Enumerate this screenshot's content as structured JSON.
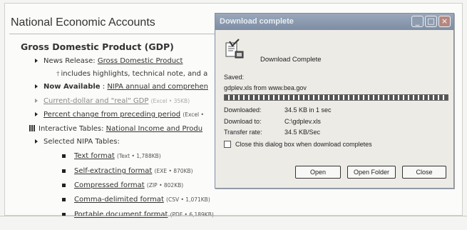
{
  "page": {
    "title": "National Economic Accounts",
    "section_heading": "Gross Domestic Product (GDP)",
    "news": {
      "label": "News Release:",
      "link": "Gross Domestic Product"
    },
    "note": "includes highlights, technical note, and a",
    "available": {
      "label": "Now Available",
      "link": "NIPA annual and comprehen"
    },
    "current_dollar": {
      "link": "Current-dollar and \"real\" GDP",
      "meta": "(Excel • 35KB)"
    },
    "percent_change": {
      "link": "Percent change from preceding period",
      "meta": "(Excel •"
    },
    "interactive": {
      "label": "Interactive Tables:",
      "link": "National Income and Produ"
    },
    "selected": "Selected NIPA Tables:",
    "files": [
      {
        "link": "Text format",
        "meta": "(Text • 1,788KB)"
      },
      {
        "link": "Self-extracting format",
        "meta": "(EXE • 870KB)"
      },
      {
        "link": "Compressed format",
        "meta": "(ZIP • 802KB)"
      },
      {
        "link": "Comma-delimited format",
        "meta": "(CSV • 1,071KB)"
      },
      {
        "link": "Portable document format",
        "meta": "(PDF • 6,189KB)"
      }
    ]
  },
  "dialog": {
    "title": "Download complete",
    "heading": "Download Complete",
    "saved_label": "Saved:",
    "saved_value": "gdplev.xls from www.bea.gov",
    "progress": 1.0,
    "downloaded_label": "Downloaded:",
    "downloaded_value": "34.5 KB in 1 sec",
    "download_to_label": "Download to:",
    "download_to_value": "C:\\gdplev.xls",
    "rate_label": "Transfer rate:",
    "rate_value": "34.5 KB/Sec",
    "close_checkbox": "Close this dialog box when download completes",
    "close_checkbox_checked": false,
    "buttons": {
      "open": "Open",
      "open_folder": "Open Folder",
      "close": "Close"
    }
  }
}
